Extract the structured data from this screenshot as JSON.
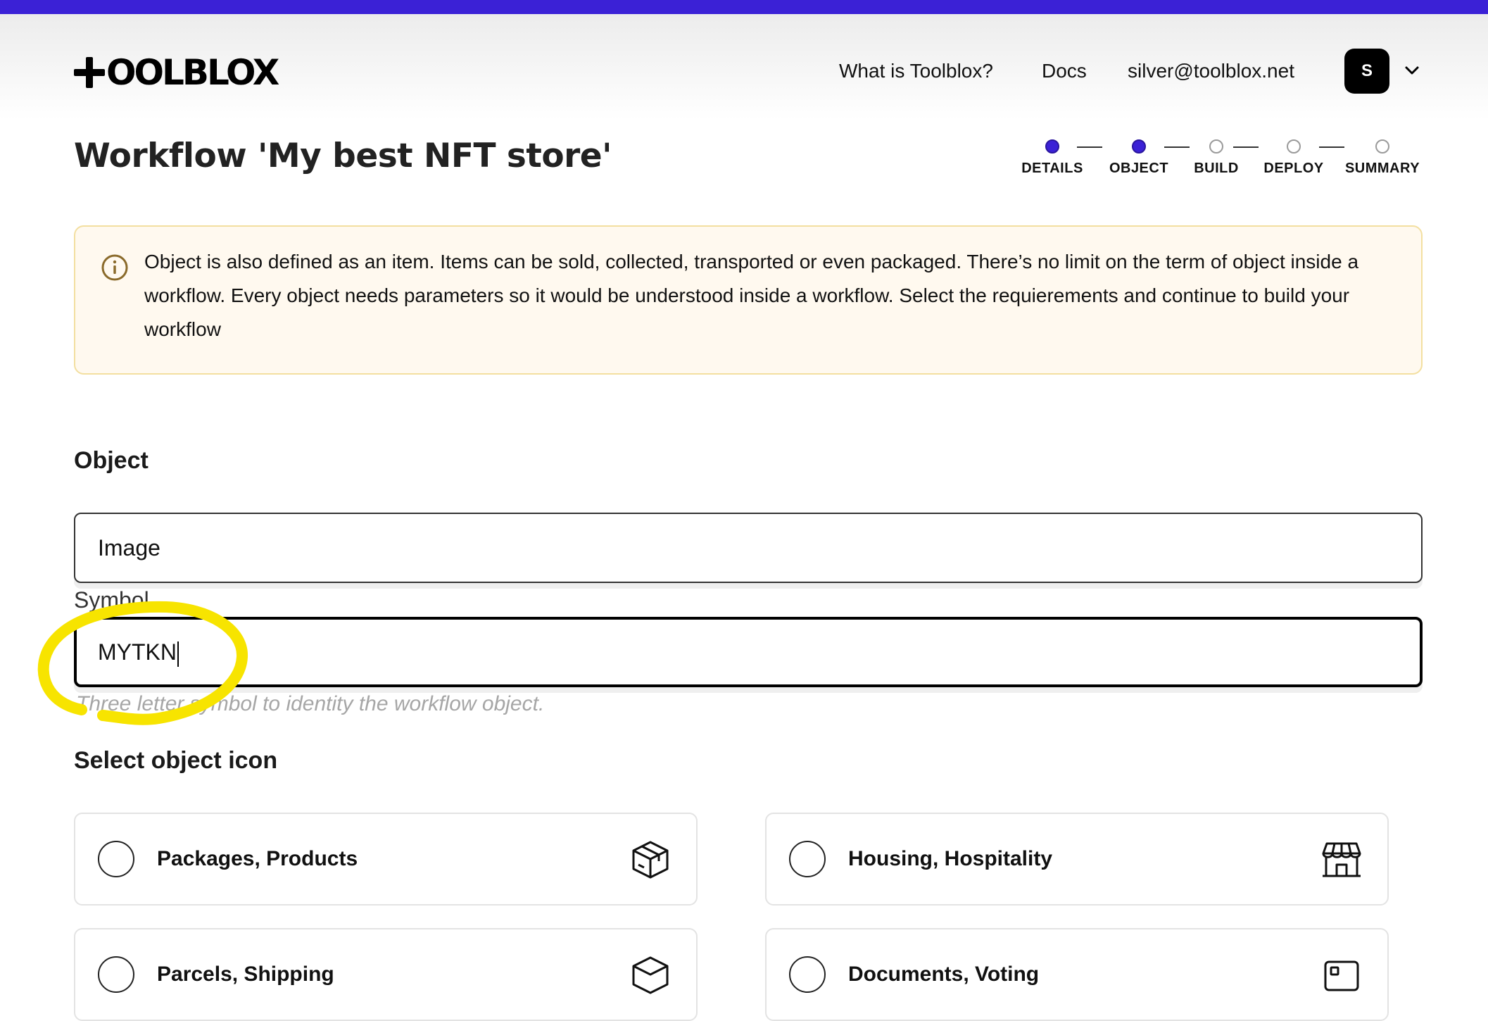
{
  "header": {
    "logo_text": "OOLBLOX",
    "nav": [
      "What is Toolblox?",
      "Docs",
      "silver@toolblox.net"
    ],
    "avatar_initial": "S"
  },
  "page": {
    "title": "Workflow 'My best NFT store'"
  },
  "stepper": {
    "steps": [
      {
        "label": "DETAILS",
        "state": "done"
      },
      {
        "label": "OBJECT",
        "state": "done"
      },
      {
        "label": "BUILD",
        "state": "todo"
      },
      {
        "label": "DEPLOY",
        "state": "todo"
      },
      {
        "label": "SUMMARY",
        "state": "todo"
      }
    ]
  },
  "notice": {
    "icon": "info-icon",
    "text": "Object is also defined as an item. Items can be sold, collected, transported or even packaged. There’s no limit on the term of object inside a workflow. Every object needs parameters so it would be understood inside a workflow. Select the requierements and continue to build your workflow"
  },
  "object_section": {
    "heading": "Object",
    "name_value": "Image",
    "symbol_label": "Symbol",
    "symbol_value": "MYTKN",
    "symbol_helper": "Three letter symbol to identity the workflow object."
  },
  "icon_section": {
    "heading": "Select object icon",
    "options": [
      {
        "label": "Packages, Products",
        "icon": "box-icon"
      },
      {
        "label": "Housing, Hospitality",
        "icon": "storefront-icon"
      },
      {
        "label": "Parcels, Shipping",
        "icon": "parcel-icon"
      },
      {
        "label": "Documents, Voting",
        "icon": "document-icon"
      }
    ]
  },
  "colors": {
    "accent": "#3b21d6",
    "notice_bg": "#fff9ef",
    "notice_border": "#f3dfa0",
    "highlight": "#f7e400"
  }
}
